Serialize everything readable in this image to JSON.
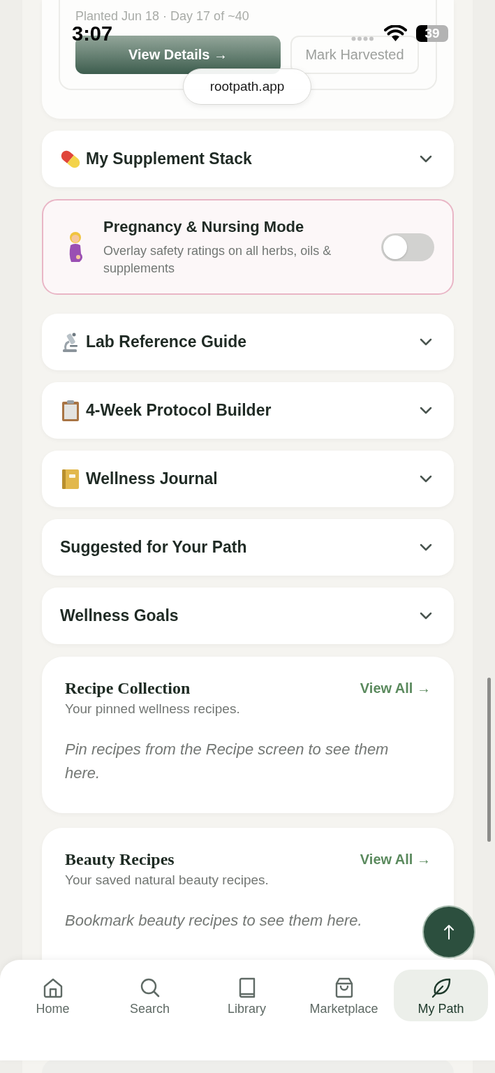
{
  "status_bar": {
    "time": "3:07",
    "battery": "39"
  },
  "browser": {
    "url": "rootpath.app"
  },
  "grow_card": {
    "meta": "Planted Jun 18 · Day 17 of ~40",
    "actions": [
      {
        "kind": "primary",
        "label": "View Details →"
      },
      {
        "kind": "secondary",
        "label": "Mark Harvested"
      }
    ]
  },
  "sections": [
    {
      "kind": "collapsible",
      "icon": true,
      "title": "My Supplement Stack",
      "expanded": false
    },
    {
      "kind": "toggle",
      "icon": true,
      "title": "Pregnancy & Nursing Mode",
      "description": "Overlay safety ratings on all herbs, oils & supplements",
      "on": false
    },
    {
      "kind": "collapsible",
      "icon": true,
      "title": "Lab Reference Guide",
      "expanded": false
    },
    {
      "kind": "collapsible",
      "icon": true,
      "title": "4-Week Protocol Builder",
      "expanded": false
    },
    {
      "kind": "collapsible",
      "icon": true,
      "title": "Wellness Journal",
      "expanded": false
    },
    {
      "kind": "collapsible",
      "icon": false,
      "title": "Suggested for Your Path",
      "expanded": false
    },
    {
      "kind": "collapsible",
      "icon": false,
      "title": "Wellness Goals",
      "expanded": false
    }
  ],
  "collections": [
    {
      "title": "Recipe Collection",
      "subtitle": "Your pinned wellness recipes.",
      "link": "View All →",
      "empty_message": "Pin recipes from the Recipe screen to see them here."
    },
    {
      "title": "Beauty Recipes",
      "subtitle": "Your saved natural beauty recipes.",
      "link": "View All →",
      "empty_message": "Bookmark beauty recipes to see them here."
    }
  ],
  "tab_bar": [
    {
      "label": "Home",
      "selected": false
    },
    {
      "label": "Search",
      "selected": false
    },
    {
      "label": "Library",
      "selected": false
    },
    {
      "label": "Marketplace",
      "selected": false
    },
    {
      "label": "My Path",
      "selected": true
    }
  ]
}
